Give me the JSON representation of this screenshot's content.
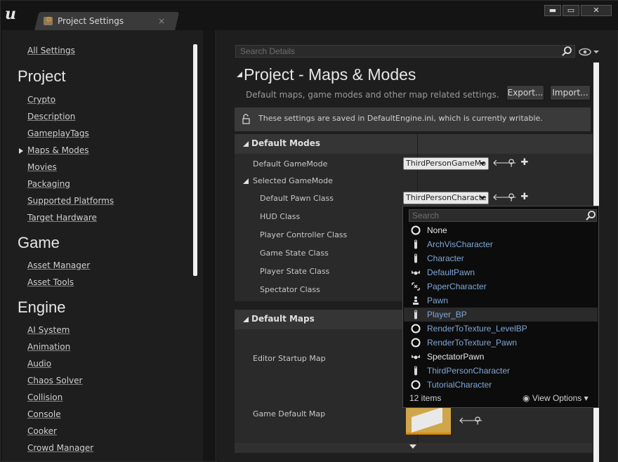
{
  "window": {
    "tab_title": "Project Settings",
    "tab_close": "×",
    "min_glyph": "▬",
    "max_glyph": "▭",
    "close_glyph": "✕"
  },
  "sidebar": {
    "all_settings": "All Settings",
    "groups": [
      {
        "heading": "Project",
        "items": [
          "Crypto",
          "Description",
          "GameplayTags",
          "Maps & Modes",
          "Movies",
          "Packaging",
          "Supported Platforms",
          "Target Hardware"
        ]
      },
      {
        "heading": "Game",
        "items": [
          "Asset Manager",
          "Asset Tools"
        ]
      },
      {
        "heading": "Engine",
        "items": [
          "AI System",
          "Animation",
          "Audio",
          "Chaos Solver",
          "Collision",
          "Console",
          "Cooker",
          "Crowd Manager"
        ]
      }
    ],
    "selected_item": "Maps & Modes"
  },
  "main": {
    "search_placeholder": "Search Details",
    "title": "Project - Maps & Modes",
    "description": "Default maps, game modes and other map related settings.",
    "export_label": "Export...",
    "import_label": "Import...",
    "notice": "These settings are saved in DefaultEngine.ini, which is currently writable.",
    "default_modes": {
      "heading": "Default Modes",
      "default_gamemode_label": "Default GameMode",
      "default_gamemode_value": "ThirdPersonGameMo",
      "selected_gamemode_label": "Selected GameMode",
      "default_pawn_label": "Default Pawn Class",
      "default_pawn_value": "ThirdPersonCharacte",
      "hud_label": "HUD Class",
      "player_controller_label": "Player Controller Class",
      "game_state_label": "Game State Class",
      "player_state_label": "Player State Class",
      "spectator_label": "Spectator Class"
    },
    "default_maps": {
      "heading": "Default Maps",
      "editor_startup_label": "Editor Startup Map",
      "game_default_label": "Game Default Map"
    }
  },
  "dropdown": {
    "search_placeholder": "Search",
    "items": [
      {
        "label": "None",
        "icon": "circle-icon",
        "color": "#e6e6e6"
      },
      {
        "label": "ArchVisCharacter",
        "icon": "character-icon",
        "color": "#7fa8d8"
      },
      {
        "label": "Character",
        "icon": "character-icon",
        "color": "#7fa8d8"
      },
      {
        "label": "DefaultPawn",
        "icon": "pawn-wings-icon",
        "color": "#7fa8d8"
      },
      {
        "label": "PaperCharacter",
        "icon": "paper-character-icon",
        "color": "#7fa8d8"
      },
      {
        "label": "Pawn",
        "icon": "pawn-icon",
        "color": "#7fa8d8"
      },
      {
        "label": "Player_BP",
        "icon": "character-icon",
        "color": "#7fa8d8"
      },
      {
        "label": "RenderToTexture_LevelBP",
        "icon": "circle-icon",
        "color": "#7fa8d8"
      },
      {
        "label": "RenderToTexture_Pawn",
        "icon": "circle-icon",
        "color": "#7fa8d8"
      },
      {
        "label": "SpectatorPawn",
        "icon": "pawn-wings-icon",
        "color": "#e6e6e6"
      },
      {
        "label": "ThirdPersonCharacter",
        "icon": "character-icon",
        "color": "#7fa8d8"
      },
      {
        "label": "TutorialCharacter",
        "icon": "circle-icon",
        "color": "#7fa8d8"
      }
    ],
    "highlighted": "Player_BP",
    "count_text": "12 items",
    "view_options": "View Options"
  }
}
